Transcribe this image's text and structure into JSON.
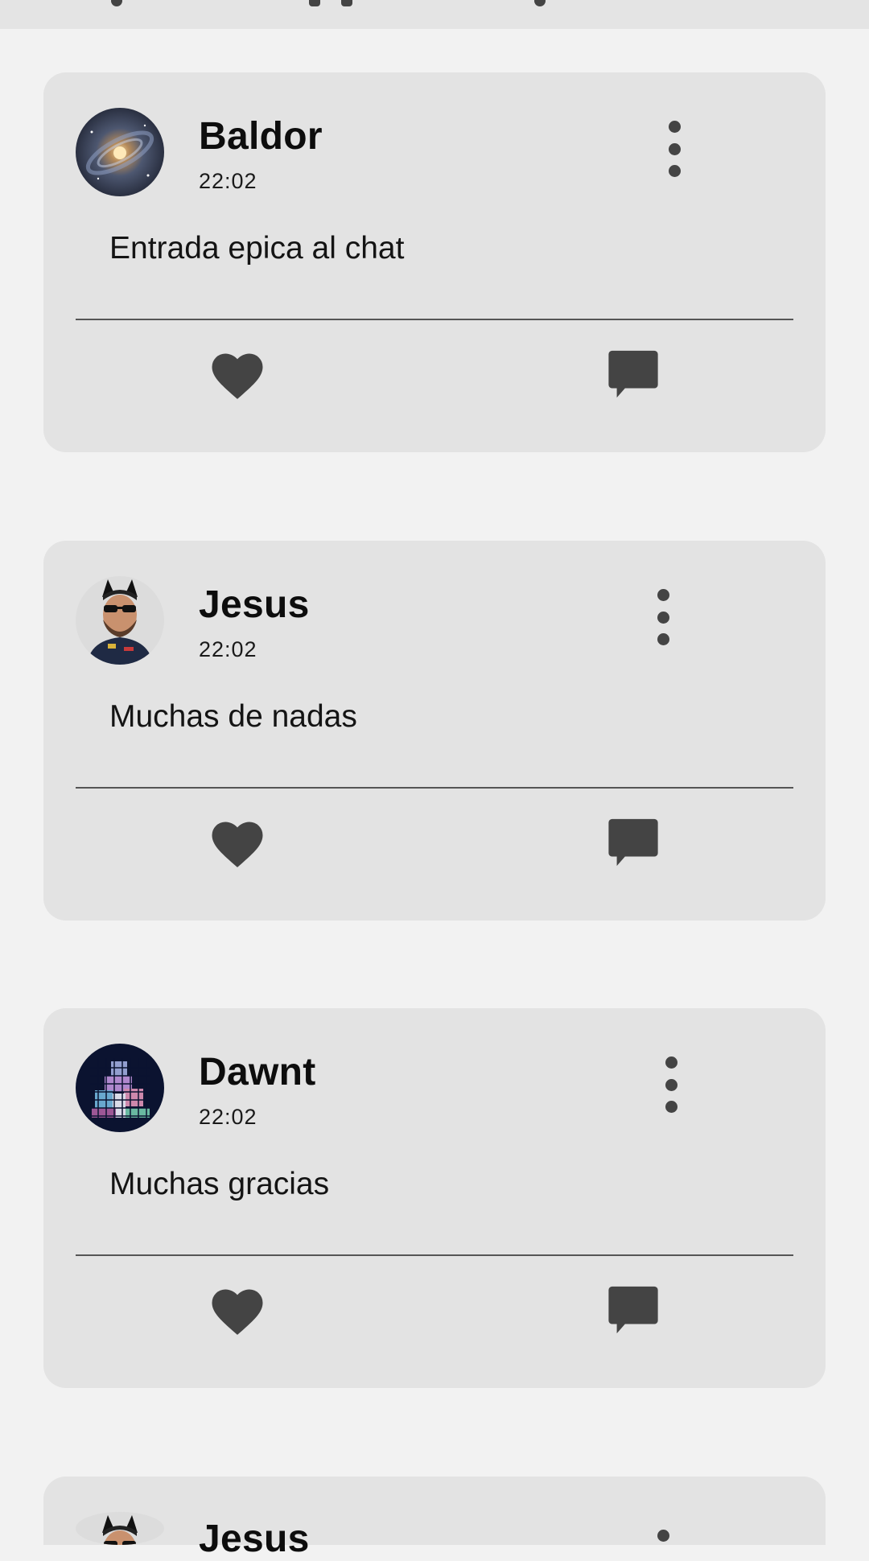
{
  "posts": [
    {
      "user": "Baldor",
      "time": "22:02",
      "message": "Entrada epica al chat",
      "avatar": "galaxy-avatar"
    },
    {
      "user": "Jesus",
      "time": "22:02",
      "message": "Muchas de nadas",
      "avatar": "bearded-man-avatar"
    },
    {
      "user": "Dawnt",
      "time": "22:02",
      "message": "Muchas gracias",
      "avatar": "pixel-figure-avatar"
    },
    {
      "user": "Jesus",
      "time": "",
      "message": "",
      "avatar": "bearded-man-avatar"
    }
  ],
  "icons": {
    "menu": "more-vert-icon",
    "like": "heart-icon",
    "comment": "comment-icon"
  },
  "colors": {
    "background": "#f2f2f2",
    "card": "#e3e3e3",
    "icon": "#444444",
    "text": "#111111"
  }
}
